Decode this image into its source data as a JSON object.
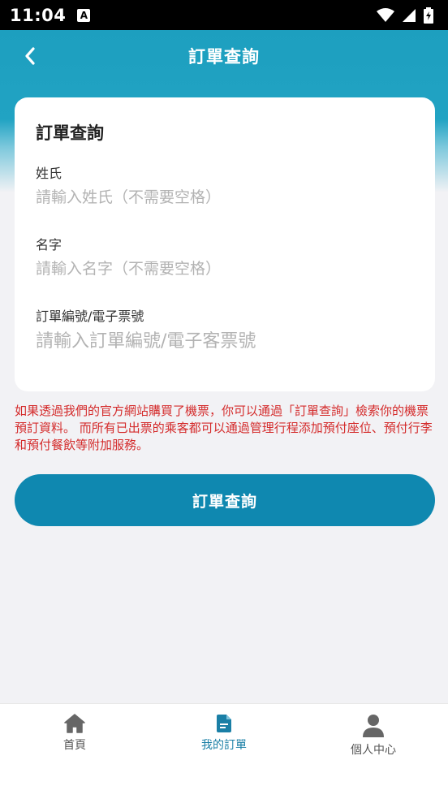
{
  "status_bar": {
    "time": "11:04",
    "a_badge": "A"
  },
  "appbar": {
    "title": "訂單查詢"
  },
  "form": {
    "card_title": "訂單查詢",
    "surname": {
      "label": "姓氏",
      "placeholder": "請輸入姓氏（不需要空格）",
      "value": ""
    },
    "given_name": {
      "label": "名字",
      "placeholder": "請輸入名字（不需要空格）",
      "value": ""
    },
    "order_number": {
      "label": "訂單編號/電子票號",
      "placeholder": "請輸入訂單編號/電子客票號",
      "value": ""
    }
  },
  "notice": "如果透過我們的官方網站購買了機票，你可以通過「訂單查詢」檢索你的機票預訂資料。 而所有已出票的乘客都可以通過管理行程添加預付座位、預付行李和預付餐飲等附加服務。",
  "submit_label": "訂單查詢",
  "bottom_nav": {
    "items": [
      {
        "label": "首頁",
        "icon": "home-icon",
        "active": false
      },
      {
        "label": "我的訂單",
        "icon": "document-icon",
        "active": true
      },
      {
        "label": "個人中心",
        "icon": "person-icon",
        "active": false
      }
    ]
  },
  "colors": {
    "brand": "#1d9fbf",
    "button": "#0f88b0",
    "active_nav": "#1a7fa6",
    "notice": "#d42b2b"
  }
}
